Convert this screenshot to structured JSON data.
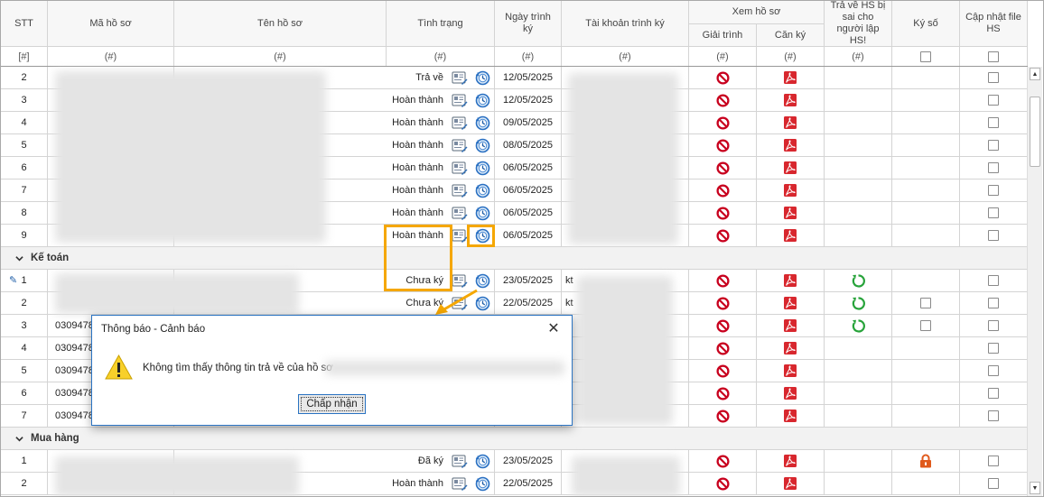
{
  "header": {
    "stt": "STT",
    "ma_ho_so": "Mã hồ sơ",
    "ten_ho_so": "Tên hồ sơ",
    "tinh_trang": "Tình trạng",
    "ngay_trinh_ky": "Ngày trình ký",
    "tai_khoan_trinh_ky": "Tài khoản trình ký",
    "xem_ho_so": "Xem hồ sơ",
    "giai_trinh": "Giải trình",
    "can_ky": "Căn ký",
    "tra_ve": "Trả về HS bị sai cho người lập HS!",
    "ky_so": "Ký số",
    "cap_nhat": "Cập nhật file HS"
  },
  "filter": {
    "stt": "[#]",
    "hash": "(#)"
  },
  "groups": [
    {
      "label": ""
    },
    {
      "label": "Kế toán"
    },
    {
      "label": "Mua hàng"
    }
  ],
  "rows_group1": [
    {
      "stt": "2",
      "status": "Trả về",
      "date": "12/05/2025"
    },
    {
      "stt": "3",
      "status": "Hoàn thành",
      "date": "12/05/2025"
    },
    {
      "stt": "4",
      "status": "Hoàn thành",
      "date": "09/05/2025"
    },
    {
      "stt": "5",
      "status": "Hoàn thành",
      "date": "08/05/2025"
    },
    {
      "stt": "6",
      "status": "Hoàn thành",
      "date": "06/05/2025"
    },
    {
      "stt": "7",
      "status": "Hoàn thành",
      "date": "06/05/2025"
    },
    {
      "stt": "8",
      "status": "Hoàn thành",
      "date": "06/05/2025"
    },
    {
      "stt": "9",
      "status": "Hoàn thành",
      "date": "06/05/2025"
    }
  ],
  "rows_group2": [
    {
      "stt": "1",
      "ma": "",
      "status": "Chưa ký",
      "date": "23/05/2025",
      "tk": "kt"
    },
    {
      "stt": "2",
      "ma": "",
      "status": "Chưa ký",
      "date": "22/05/2025",
      "tk": "kt"
    },
    {
      "stt": "3",
      "ma": "0309478",
      "status": "",
      "date": "",
      "tk": ""
    },
    {
      "stt": "4",
      "ma": "0309478",
      "status": "",
      "date": "",
      "tk": ""
    },
    {
      "stt": "5",
      "ma": "0309478",
      "status": "",
      "date": "",
      "tk": ""
    },
    {
      "stt": "6",
      "ma": "0309478",
      "status": "",
      "date": "",
      "tk": ""
    },
    {
      "stt": "7",
      "ma": "0309478",
      "status": "",
      "date": "",
      "tk": ""
    }
  ],
  "rows_group3": [
    {
      "stt": "1",
      "status": "Đã ký",
      "date": "23/05/2025"
    },
    {
      "stt": "2",
      "status": "Hoàn thành",
      "date": "22/05/2025"
    }
  ],
  "dialog": {
    "title": "Thông báo - Cảnh báo",
    "message": "Không tìm thấy thông tin trả về của hồ sơ",
    "ok_label": "Chấp nhận"
  },
  "icons": {
    "warning": "warning-icon",
    "pdf": "pdf-icon",
    "forbidden": "forbidden-icon",
    "revert": "revert-icon",
    "lock": "lock-icon",
    "edit_doc": "edit-document-icon",
    "history": "history-icon"
  },
  "colors": {
    "highlight": "#f5a700",
    "forbidden": "#c8001e",
    "pdf": "#d8272e",
    "revert": "#27a33a",
    "lock": "#e05a1c"
  }
}
